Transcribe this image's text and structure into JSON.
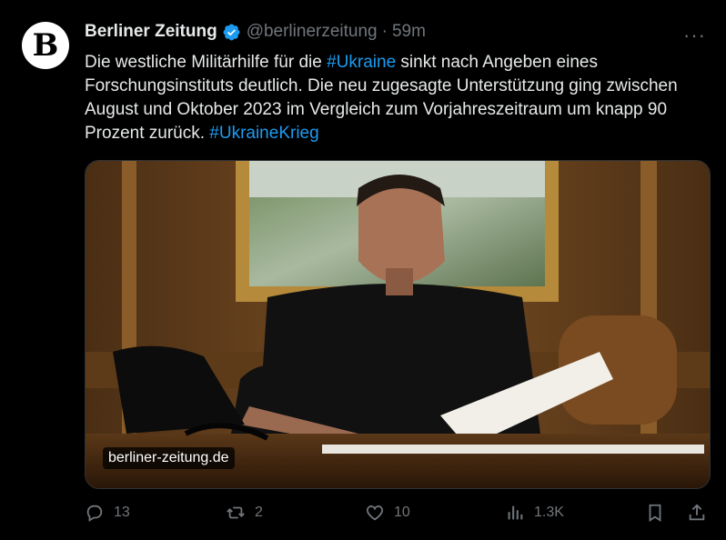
{
  "tweet": {
    "author_name": "Berliner Zeitung",
    "handle": "@berlinerzeitung",
    "separator": "·",
    "time": "59m",
    "avatar_glyph": "B",
    "text_part1": "Die westliche Militärhilfe für die ",
    "hashtag1": "#Ukraine",
    "text_part2": " sinkt nach Angeben eines Forschungsinstituts deutlich. Die neu zugesagte Unterstützung ging zwischen August und Oktober 2023 im Vergleich zum Vorjahreszeitraum um knapp 90 Prozent zurück. ",
    "hashtag2": "#UkraineKrieg",
    "media_source": "berliner-zeitung.de",
    "more_label": "···"
  },
  "actions": {
    "replies": "13",
    "reposts": "2",
    "likes": "10",
    "views": "1.3K"
  },
  "colors": {
    "background": "#000000",
    "text": "#e7e9ea",
    "muted": "#71767b",
    "accent": "#1d9bf0"
  },
  "icons": [
    "verified-badge-icon",
    "more-icon",
    "reply-icon",
    "repost-icon",
    "like-icon",
    "views-icon",
    "bookmark-icon",
    "share-icon"
  ]
}
